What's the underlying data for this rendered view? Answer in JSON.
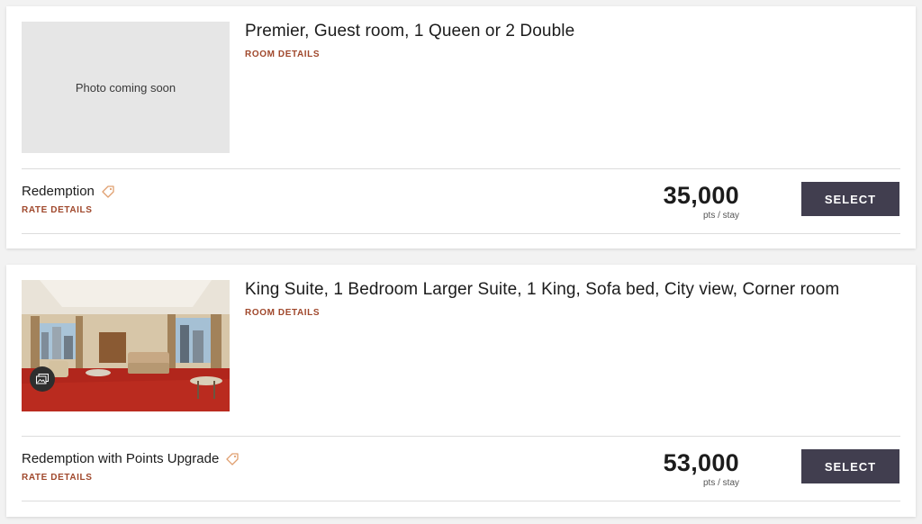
{
  "rooms": [
    {
      "title": "Premier, Guest room, 1 Queen or 2 Double",
      "room_details_label": "ROOM DETAILS",
      "photo_placeholder": "Photo coming soon",
      "rate": {
        "name": "Redemption",
        "rate_details_label": "RATE DETAILS",
        "price": "35,000",
        "unit": "pts / stay",
        "select_label": "SELECT"
      }
    },
    {
      "title": "King Suite, 1 Bedroom Larger Suite, 1 King, Sofa bed, City view, Corner room",
      "room_details_label": "ROOM DETAILS",
      "photo_icon": "gallery-icon",
      "rate": {
        "name": "Redemption with Points Upgrade",
        "rate_details_label": "RATE DETAILS",
        "price": "53,000",
        "unit": "pts / stay",
        "select_label": "SELECT"
      }
    }
  ],
  "colors": {
    "accent_link": "#a0482c",
    "button_bg": "#413e4f",
    "tag_icon": "#e0a070"
  }
}
